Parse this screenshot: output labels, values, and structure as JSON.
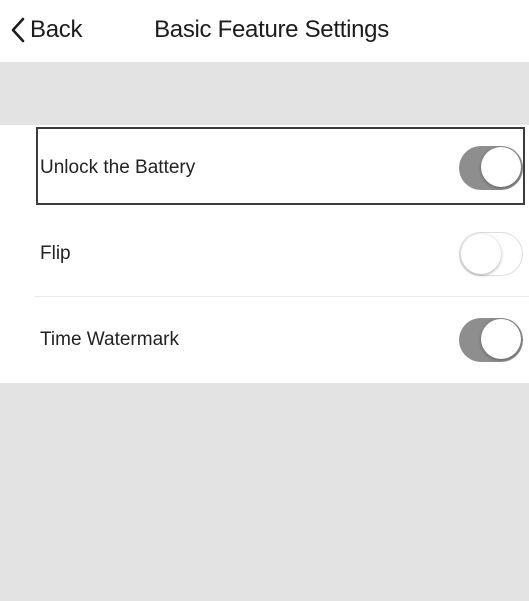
{
  "nav": {
    "back_label": "Back",
    "title": "Basic Feature Settings"
  },
  "settings": {
    "items": [
      {
        "label": "Unlock the Battery",
        "enabled": true,
        "focused": true
      },
      {
        "label": "Flip",
        "enabled": false,
        "focused": false
      },
      {
        "label": "Time Watermark",
        "enabled": true,
        "focused": false
      }
    ]
  },
  "colors": {
    "toggle_on": "#8e8e8e",
    "toggle_off": "#ffffff",
    "background_gray": "#e3e3e3"
  },
  "icons": {
    "back": "chevron-left-icon"
  }
}
